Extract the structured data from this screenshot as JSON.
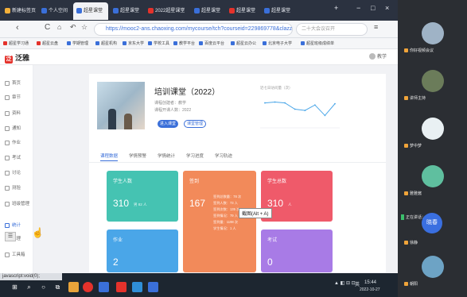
{
  "browser": {
    "tabs": [
      {
        "label": "新建标签页",
        "color": "#f2b03a"
      },
      {
        "label": "个人空间",
        "color": "#3a6fd9"
      },
      {
        "label": "超星课堂",
        "color": "#3a6fd9"
      },
      {
        "label": "超星课堂",
        "color": "#3a6fd9"
      },
      {
        "label": "2022超星课堂",
        "color": "#e4322b"
      },
      {
        "label": "超星课堂",
        "color": "#3a6fd9"
      },
      {
        "label": "超星课堂",
        "color": "#e4322b"
      },
      {
        "label": "超星课堂",
        "color": "#3a6fd9"
      }
    ],
    "window_controls": [
      "−",
      "□",
      "×"
    ],
    "url": "https://mooc2-ans.chaoxing.com/mycourse/tch?courseid=229869778&clazzid=",
    "search_placeholder": "二十大会议召开",
    "bookmarks": [
      {
        "label": "超星学习通",
        "color": "#e4322b"
      },
      {
        "label": "超星云盘",
        "color": "#e4322b"
      },
      {
        "label": "学期管理",
        "color": "#3a6fd9"
      },
      {
        "label": "超星机构",
        "color": "#3a6fd9"
      },
      {
        "label": "京东大学",
        "color": "#3a6fd9"
      },
      {
        "label": "学校工具",
        "color": "#3a6fd9"
      },
      {
        "label": "教学平台",
        "color": "#3a6fd9"
      },
      {
        "label": "百度云平台",
        "color": "#3a6fd9"
      },
      {
        "label": "超星云办公",
        "color": "#3a6fd9"
      },
      {
        "label": "北京电子大学",
        "color": "#3a6fd9"
      },
      {
        "label": "超星班级成绩单",
        "color": "#3a6fd9"
      }
    ]
  },
  "app": {
    "logo_text": "泛雅",
    "logo_mark": "泛",
    "user": "教学"
  },
  "sidebar": {
    "items": [
      {
        "label": "首页"
      },
      {
        "label": "章节"
      },
      {
        "label": "资料"
      },
      {
        "label": "通知"
      },
      {
        "label": "作业"
      },
      {
        "label": "考试"
      },
      {
        "label": "讨论"
      },
      {
        "label": "测验"
      },
      {
        "label": "班级管理"
      },
      {
        "label": "统计"
      },
      {
        "label": "管理"
      },
      {
        "label": "工具箱"
      }
    ],
    "active_index": 9
  },
  "course": {
    "title": "培训课堂（2022）",
    "meta_lines": [
      "课程创建者：教学",
      "课程开课人数：2022"
    ],
    "enter_button": "进入课堂",
    "edit_button": "课堂管理",
    "chart_title": "近七日访问量（次）",
    "chart_values": [
      70,
      72,
      70,
      55,
      52,
      65,
      40,
      68
    ]
  },
  "content_tabs": {
    "items": [
      "课程数据",
      "学情预警",
      "学情统计",
      "学习进度",
      "学习轨迹"
    ],
    "active_index": 0
  },
  "stats": [
    {
      "label": "学生人数",
      "value": "310",
      "sub": "男 82 人",
      "color": "#45c3b2"
    },
    {
      "label": "签到",
      "value": "167",
      "sub": "",
      "color": "#f28a5a",
      "details": [
        "签到总数量：78 次",
        "签到人数：73 人",
        "签到次数：135 次",
        "签到情况：79 人",
        "签到量：1198 次",
        "学生情况：1 人"
      ]
    },
    {
      "label": "学生总数",
      "value": "310",
      "sub": "人",
      "color": "#ef5a6a"
    },
    {
      "label": "作业",
      "value": "2",
      "sub": "",
      "color": "#4aa6e8"
    },
    {
      "label": "考试",
      "value": "0",
      "sub": "",
      "color": "#a87be6"
    }
  ],
  "tooltip": "截图(Alt + A)",
  "status_text": "javascript:void(0);",
  "taskbar": {
    "clock": "15:44",
    "date": "2022-10-27",
    "lang": "英"
  },
  "participants": [
    {
      "name": "你好视频会议",
      "avatar_color": "#9fb3c6"
    },
    {
      "name": "讲师主持",
      "avatar_color": "#6b7c5a"
    },
    {
      "name": "梦中梦",
      "avatar_color": "#e9f0f3"
    },
    {
      "name": "雅雅酱",
      "avatar_color": "#5fbf9f"
    },
    {
      "name": "徐静",
      "avatar_color": "#3a6fe0",
      "initials": "晓春"
    },
    {
      "name": "朝阳",
      "avatar_color": "#6da3c5"
    }
  ],
  "speaking": "正在讲话：徐静"
}
